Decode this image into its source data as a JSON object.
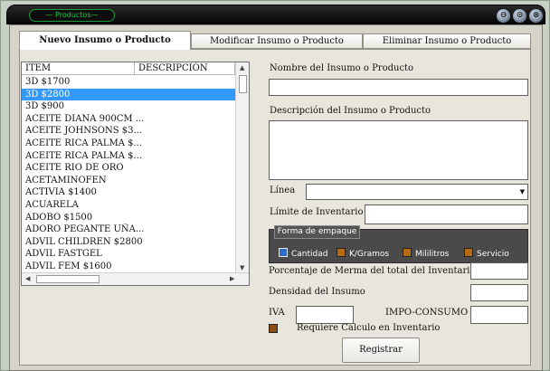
{
  "window": {
    "title": "— Productos—",
    "controls": [
      "⊖",
      "⊙",
      "⊗"
    ]
  },
  "tabs": [
    {
      "label": "Nuevo Insumo o Producto",
      "active": true
    },
    {
      "label": "Modificar Insumo o Producto",
      "active": false
    },
    {
      "label": "Eliminar Insumo o Producto",
      "active": false
    }
  ],
  "list": {
    "headers": [
      "ITEM",
      "DESCRIPCIÓN"
    ],
    "items": [
      "3D $1700",
      "3D $2800",
      "3D $900",
      "ACEITE DIANA 900CM ...",
      "ACEITE JOHNSONS $3...",
      "ACEITE RICA PALMA $...",
      "ACEITE RICA PALMA $...",
      "ACEITE RIO DE ORO",
      "ACETAMINOFEN",
      "ACTIVIA $1400",
      "ACUARELA",
      "ADOBO $1500",
      "ADORO PEGANTE UÑA...",
      "ADVIL CHILDREN $2800",
      "ADVIL FASTGEL",
      "ADVIL FEM $1600"
    ],
    "selected_index": 1
  },
  "form": {
    "name_label": "Nombre del Insumo o Producto",
    "name_value": "",
    "description_label": "Descripción del Insumo o Producto",
    "description_value": "",
    "line_label": "Línea",
    "line_value": "",
    "inventory_limit_label": "Límite de Inventario",
    "inventory_limit_value": "",
    "packaging": {
      "title": "Forma de empaque",
      "options": [
        {
          "label": "Cantidad",
          "checked": true
        },
        {
          "label": "K/Gramos",
          "checked": false
        },
        {
          "label": "Mililitros",
          "checked": false
        },
        {
          "label": "Servicio",
          "checked": false
        }
      ]
    },
    "merma_label": "Porcentaje de Merma del total del Inventario",
    "merma_value": "",
    "density_label": "Densidad del Insumo",
    "density_value": "",
    "iva_label": "IVA",
    "iva_value": "",
    "impoconsumo_label": "IMPO-CONSUMO",
    "impoconsumo_value": "",
    "requires_calc_label": "Requiere Calculo en Inventario",
    "register_button": "Registrar"
  }
}
